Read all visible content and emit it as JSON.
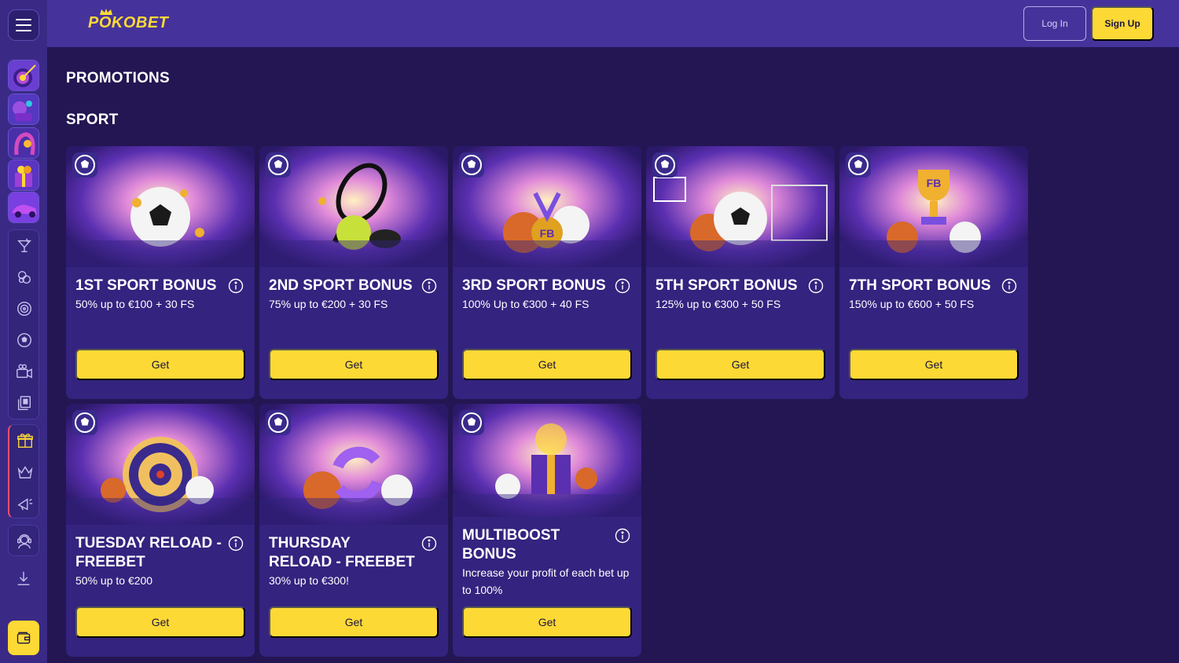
{
  "header": {
    "logo_text": "POKOBET",
    "login_label": "Log In",
    "signup_label": "Sign Up"
  },
  "page": {
    "title": "PROMOTIONS",
    "section": "SPORT"
  },
  "colors": {
    "background": "#231652",
    "header": "#45339b",
    "card": "#34237f",
    "accent": "#fdd935"
  },
  "sidebar": {
    "games": [
      "target-game-icon",
      "joystick-game-icon",
      "horseshoe-game-icon",
      "gift-box-game-icon",
      "car-game-icon"
    ],
    "group1": [
      "cocktail-icon",
      "sports-balls-icon",
      "roulette-icon",
      "soccer-ball-icon",
      "live-tv-icon",
      "betslip-icon"
    ],
    "group2": [
      "gift-icon",
      "crown-icon",
      "megaphone-icon"
    ],
    "support_icon": "support-agent-icon",
    "download_icon": "download-icon",
    "wallet_icon": "wallet-icon"
  },
  "cards": [
    {
      "title": "1ST SPORT BONUS",
      "sub": "50% up to €100 + 30 FS",
      "button": "Get"
    },
    {
      "title": "2ND SPORT BONUS",
      "sub": "75% up to €200 + 30 FS",
      "button": "Get"
    },
    {
      "title": "3RD SPORT BONUS",
      "sub": "100% Up to €300 + 40 FS",
      "button": "Get"
    },
    {
      "title": "5TH SPORT BONUS",
      "sub": "125% up to €300 + 50 FS",
      "button": "Get"
    },
    {
      "title": "7TH SPORT BONUS",
      "sub": "150% up to €600 + 50 FS",
      "button": "Get"
    },
    {
      "title": "TUESDAY RELOAD - FREEBET",
      "sub": "50% up to €200",
      "button": "Get"
    },
    {
      "title": "THURSDAY RELOAD - FREEBET",
      "sub": "30% up to €300!",
      "button": "Get"
    },
    {
      "title": "MULTIBOOST BONUS",
      "sub": "Increase your profit of each bet up to 100%",
      "button": "Get"
    }
  ]
}
